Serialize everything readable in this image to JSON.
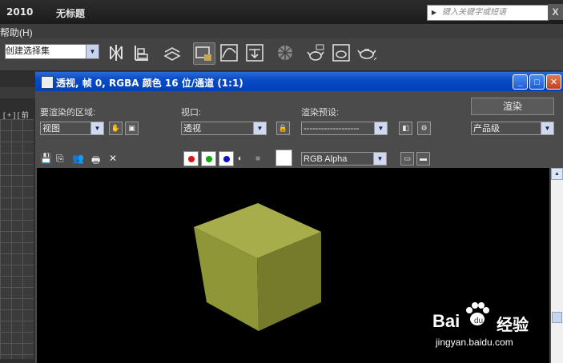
{
  "app": {
    "version": "2010",
    "doc_title": "无标题",
    "search_placeholder": "键入关键字或短语",
    "close_label": "X"
  },
  "menu": {
    "help": "帮助(H)"
  },
  "toolbar": {
    "selection_set": "创建选择集"
  },
  "left_view": {
    "label": "[ + ] [ 前"
  },
  "render_window": {
    "title": "透视, 帧 0, RGBA 颜色 16 位/通道 (1:1)",
    "area_label": "要渲染的区域:",
    "area_value": "视图",
    "viewport_label": "视口:",
    "viewport_value": "透视",
    "preset_label": "渲染预设:",
    "preset_value": "-------------------",
    "render_button": "渲染",
    "quality_value": "产品级",
    "channel_value": "RGB Alpha"
  },
  "colors": {
    "cube_top": "#a6ad4a",
    "cube_left": "#8f9638",
    "cube_right": "#757b2a",
    "titlebar": "#0a4ac4"
  },
  "watermark": {
    "brand": "Bai",
    "brand2": "经验",
    "url": "jingyan.baidu.com"
  }
}
